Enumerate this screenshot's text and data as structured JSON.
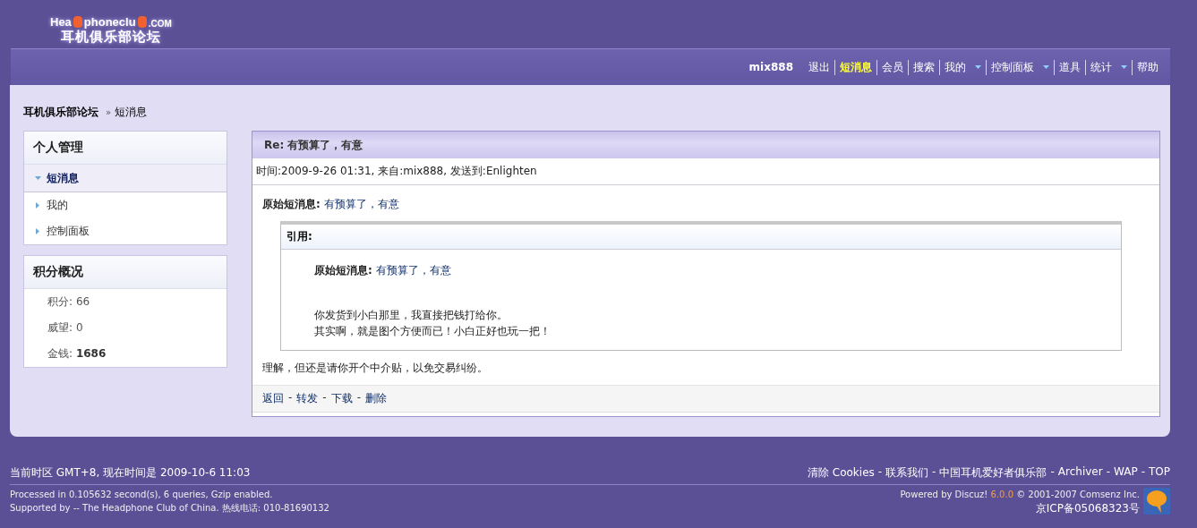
{
  "header": {
    "logo": {
      "parts": [
        "Hea",
        "phoneclu",
        ".COM"
      ],
      "subtitle": "耳机俱乐部论坛"
    },
    "user": "mix888",
    "nav": [
      {
        "label": "退出",
        "selected": false,
        "dropdown": false
      },
      {
        "label": "短消息",
        "selected": true,
        "dropdown": false
      },
      {
        "label": "会员",
        "selected": false,
        "dropdown": false
      },
      {
        "label": "搜索",
        "selected": false,
        "dropdown": false
      },
      {
        "label": "我的",
        "selected": false,
        "dropdown": true
      },
      {
        "label": "控制面板",
        "selected": false,
        "dropdown": true
      },
      {
        "label": "道具",
        "selected": false,
        "dropdown": false
      },
      {
        "label": "统计",
        "selected": false,
        "dropdown": true
      },
      {
        "label": "帮助",
        "selected": false,
        "dropdown": false
      }
    ]
  },
  "breadcrumb": {
    "items": [
      "耳机俱乐部论坛",
      "短消息"
    ],
    "separator": "»"
  },
  "sidebar": [
    {
      "kind": "menu",
      "title": "个人管理",
      "items": [
        {
          "label": "短消息",
          "selected": true
        },
        {
          "label": "我的",
          "selected": false
        },
        {
          "label": "控制面板",
          "selected": false
        }
      ]
    },
    {
      "kind": "stats",
      "title": "积分概况",
      "items": [
        {
          "label": "积分:",
          "value": "66",
          "emphasis": false
        },
        {
          "label": "威望:",
          "value": "0",
          "emphasis": false
        },
        {
          "label": "金钱:",
          "value": "1686",
          "emphasis": true
        }
      ]
    }
  ],
  "message": {
    "title": "Re: 有预算了，有意",
    "meta": "时间:2009-9-26 01:31, 来自:mix888, 发送到:Enlighten",
    "original": {
      "label": "原始短消息:",
      "link": "有预算了，有意"
    },
    "quote": {
      "title": "引用:",
      "original": {
        "label": "原始短消息:",
        "link": "有预算了，有意"
      },
      "lines": [
        "你发货到小白那里，我直接把钱打给你。",
        "其实啊，就是图个方便而已！小白正好也玩一把！"
      ]
    },
    "reply": "理解，但还是请你开个中介贴，以免交易纠纷。",
    "actions": [
      "返回",
      "转发",
      "下载",
      "删除"
    ],
    "separator": "-"
  },
  "footer": {
    "timezone": "当前时区  GMT+8, 现在时间是  2009-10-6 11:03",
    "links": [
      "清除  Cookies",
      "联系我们",
      "中国耳机爱好者俱乐部",
      "Archiver",
      "WAP",
      "TOP"
    ],
    "separator": "-",
    "processed": "Processed in 0.105632 second(s), 6 queries, Gzip enabled.",
    "supported": "Supported by -- The Headphone Club of China. 热线电话: 010-81690132",
    "powered": {
      "before": "Powered by Discuz!",
      "version": "6.0.0",
      "after": "© 2001-2007 Comsenz Inc."
    },
    "icp": "京ICP备05068323号"
  }
}
